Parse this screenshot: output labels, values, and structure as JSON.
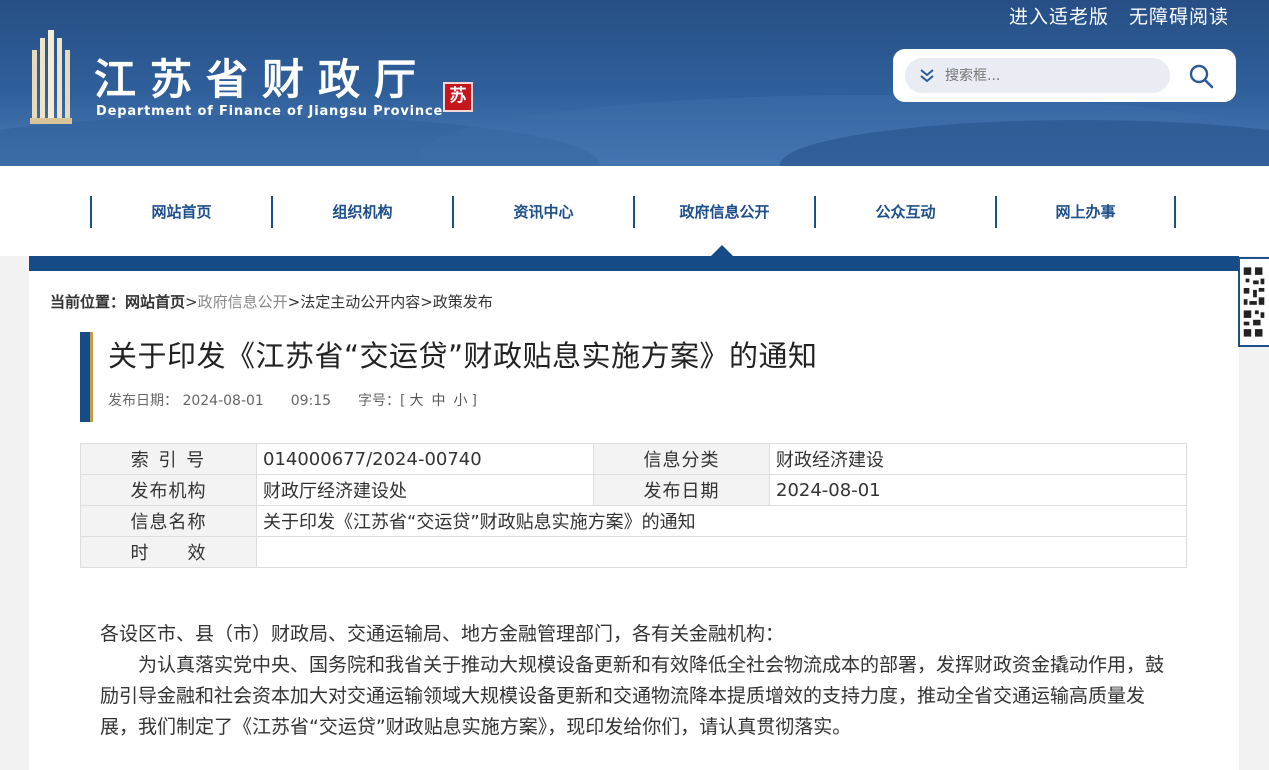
{
  "header": {
    "senior_mode": "进入适老版",
    "accessible": "无障碍阅读",
    "site_title": "江苏省财政厅",
    "site_subtitle": "Department of Finance of Jiangsu Province",
    "seal_char": "苏",
    "search_placeholder": "搜索框..."
  },
  "nav": {
    "items": [
      {
        "label": "网站首页"
      },
      {
        "label": "组织机构"
      },
      {
        "label": "资讯中心"
      },
      {
        "label": "政府信息公开"
      },
      {
        "label": "公众互动"
      },
      {
        "label": "网上办事"
      }
    ]
  },
  "breadcrumb": {
    "label": "当前位置：",
    "home": "网站首页",
    "items": [
      ">",
      "政府信息公开",
      ">法定主动公开内容",
      ">政策发布"
    ]
  },
  "article": {
    "title": "关于印发《江苏省“交运贷”财政贴息实施方案》的通知",
    "date_label": "发布日期：",
    "date": "2024-08-01",
    "time": "09:15",
    "font_label": "字号：[",
    "font_large": "大",
    "font_medium": "中",
    "font_small": "小",
    "font_end": "]"
  },
  "info_table": {
    "index_label": "索 引 号",
    "index_value": "014000677/2024-00740",
    "category_label": "信息分类",
    "category_value": "财政经济建设",
    "org_label": "发布机构",
    "org_value": "财政厅经济建设处",
    "date_label": "发布日期",
    "date_value": "2024-08-01",
    "name_label": "信息名称",
    "name_value": "关于印发《江苏省“交运贷”财政贴息实施方案》的通知",
    "valid_label": "时　　效",
    "valid_value": ""
  },
  "body": {
    "salutation": "各设区市、县（市）财政局、交通运输局、地方金融管理部门，各有关金融机构：",
    "paragraph1": "为认真落实党中央、国务院和我省关于推动大规模设备更新和有效降低全社会物流成本的部署，发挥财政资金撬动作用，鼓励引导金融和社会资本加大对交通运输领域大规模设备更新和交通物流降本提质增效的支持力度，推动全省交通运输高质量发展，我们制定了《江苏省“交运贷”财政贴息实施方案》，现印发给你们，请认真贯彻落实。"
  },
  "colors": {
    "brand_blue": "#164b86",
    "accent_gold": "#c79a4a",
    "seal_red": "#c4161c"
  }
}
